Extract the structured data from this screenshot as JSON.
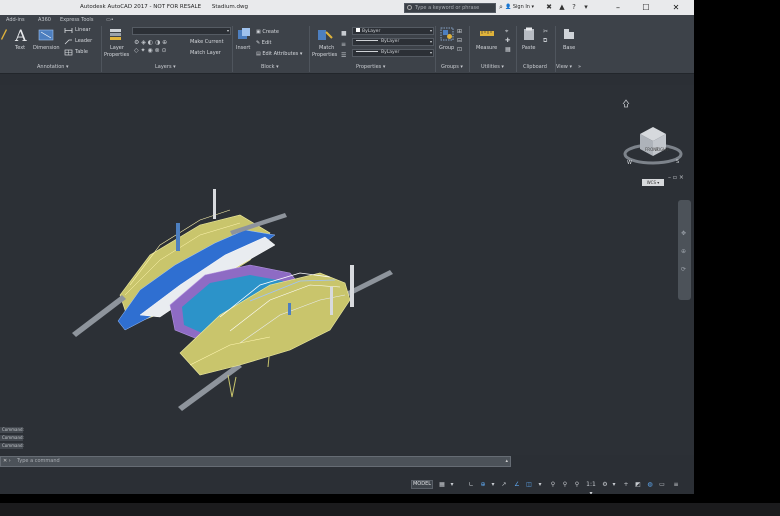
{
  "window": {
    "product": "Autodesk AutoCAD 2017 - NOT FOR RESALE",
    "document": "Stadium.dwg",
    "minimize": "–",
    "maximize": "☐",
    "close": "✕"
  },
  "search": {
    "placeholder": "Type a keyword or phrase"
  },
  "account": {
    "sign_in": "Sign In"
  },
  "menu_tabs": [
    "Add-ins",
    "A360",
    "Express Tools",
    "▭•"
  ],
  "ribbon": {
    "annotation": {
      "text": "Text",
      "dimension": "Dimension",
      "linear": "Linear",
      "leader": "Leader",
      "table": "Table",
      "label": "Annotation ▾"
    },
    "layers": {
      "layer_properties_1": "Layer",
      "layer_properties_2": "Properties",
      "make_current": "Make Current",
      "match_layer": "Match Layer",
      "label": "Layers ▾"
    },
    "block": {
      "insert": "Insert",
      "create": "Create",
      "edit": "Edit",
      "edit_attributes": "Edit Attributes ▾",
      "label": "Block ▾"
    },
    "properties": {
      "match_1": "Match",
      "match_2": "Properties",
      "bylayer_1": "ByLayer",
      "bylayer_2": "ByLayer",
      "bylayer_3": "ByLayer",
      "label": "Properties ▾"
    },
    "groups": {
      "group": "Group",
      "label": "Groups ▾"
    },
    "utilities": {
      "measure": "Measure",
      "label": "Utilities ▾"
    },
    "clipboard": {
      "paste": "Paste",
      "label": "Clipboard"
    },
    "view": {
      "base": "Base",
      "label": "View ▾"
    }
  },
  "viewcube": {
    "wcs": "WCS ▾"
  },
  "viewport_controls": "– ▫ ×",
  "command": {
    "history": [
      "Command:",
      "Command:",
      "Command:"
    ],
    "placeholder": "Type a command"
  },
  "status": {
    "model": "MODEL",
    "scale": "1:1 ▾"
  }
}
